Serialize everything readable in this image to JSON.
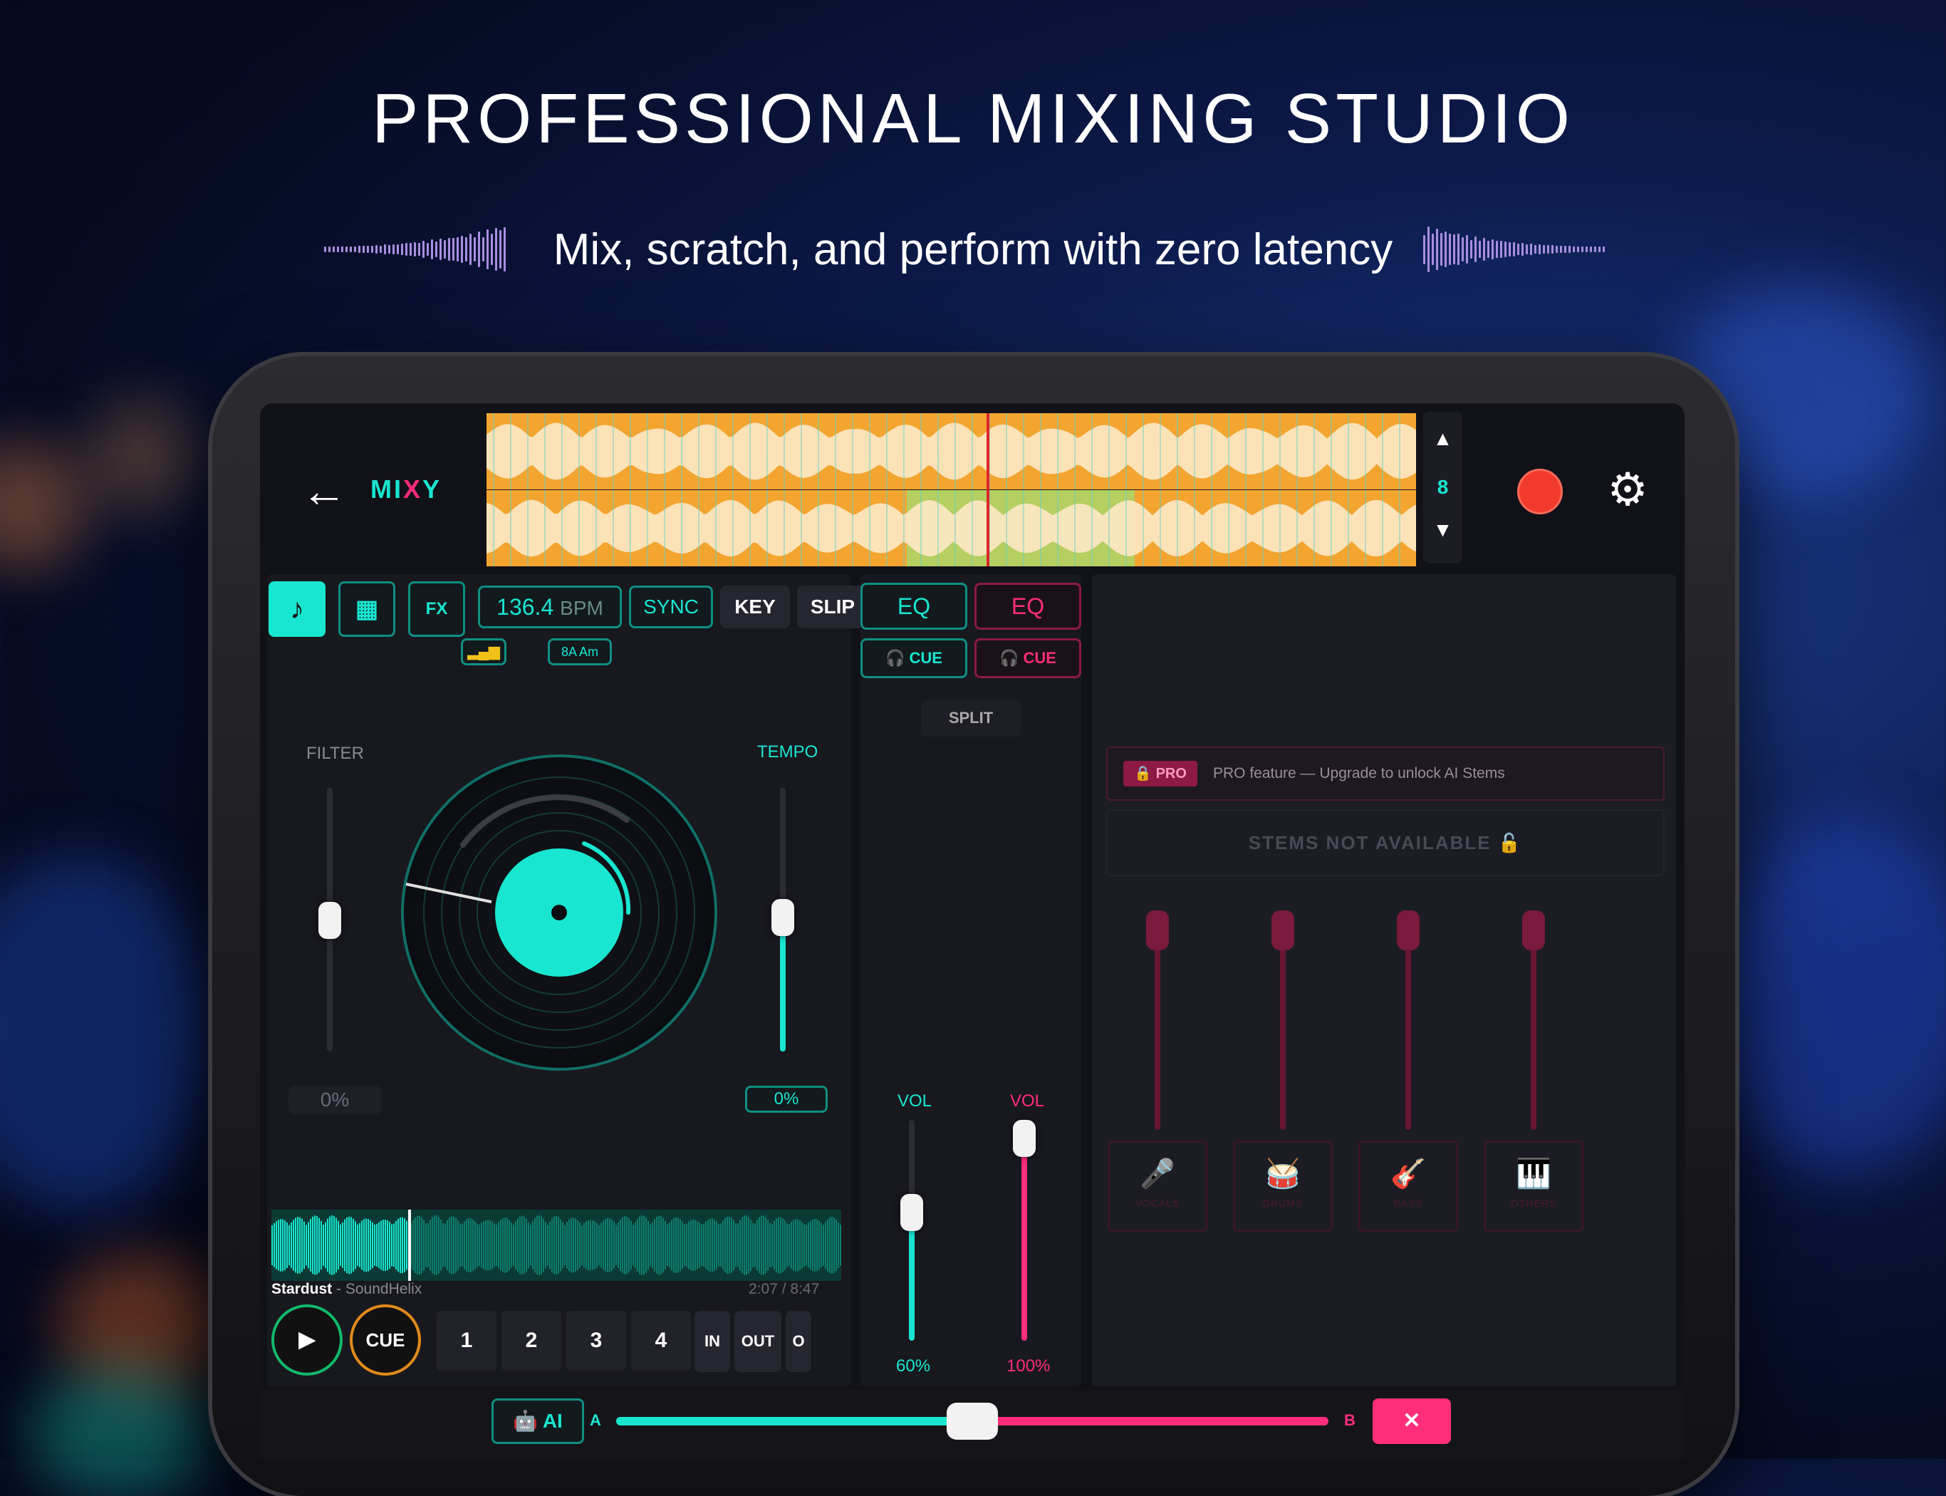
{
  "headline": "PROFESSIONAL MIXING STUDIO",
  "subline": "Mix, scratch, and perform with zero latency",
  "app": {
    "logo_left": "MI",
    "logo_mid": "X",
    "logo_right": "Y",
    "zoom_level": "8",
    "icons": {
      "back": "back-arrow-icon",
      "settings": "gear-icon",
      "record": "record-icon",
      "zoom_up": "chevron-up-icon",
      "zoom_down": "chevron-down-icon"
    }
  },
  "deck": {
    "mode_music": "♪",
    "mode_grid": "▦",
    "mode_fx": "FX",
    "bpm_value": "136.4",
    "bpm_unit": "BPM",
    "sync": "SYNC",
    "key": "KEY",
    "slip": "SLIP",
    "key_value": "8A Am",
    "filter_label": "FILTER",
    "filter_value": "0%",
    "tempo_label": "TEMPO",
    "tempo_value": "0%",
    "track_title": "Stardust",
    "track_artist": "- SoundHelix",
    "time": "2:07 / 8:47",
    "play": "▶",
    "cue": "CUE",
    "hotcues": [
      "1",
      "2",
      "3",
      "4"
    ],
    "hotcue_colors": [
      "#19e6a0",
      "#ff2d7a",
      "#2f7bff",
      "#f3c21a"
    ],
    "loop_in": "IN",
    "loop_out": "OUT",
    "loop_toggle": "O",
    "progress": 0.24
  },
  "mixer": {
    "eq_a": "EQ",
    "eq_b": "EQ",
    "cue_a": "CUE",
    "cue_b": "CUE",
    "split": "SPLIT",
    "vol_a_label": "VOL",
    "vol_b_label": "VOL",
    "vol_a_value": "60%",
    "vol_b_value": "100%",
    "vol_a_level": 0.6,
    "vol_b_level": 1.0
  },
  "stems": {
    "pro_badge": "PRO",
    "pro_text": "PRO feature — Upgrade to unlock AI Stems",
    "not_available": "STEMS NOT AVAILABLE",
    "items": [
      {
        "label": "VOCALS",
        "icon": "🎤"
      },
      {
        "label": "DRUMS",
        "icon": "🥁"
      },
      {
        "label": "BASS",
        "icon": "🎸"
      },
      {
        "label": "OTHERS",
        "icon": "🎹"
      }
    ]
  },
  "crossfader": {
    "ai": "AI",
    "a": "A",
    "b": "B",
    "close": "✕",
    "position": 0.5
  }
}
